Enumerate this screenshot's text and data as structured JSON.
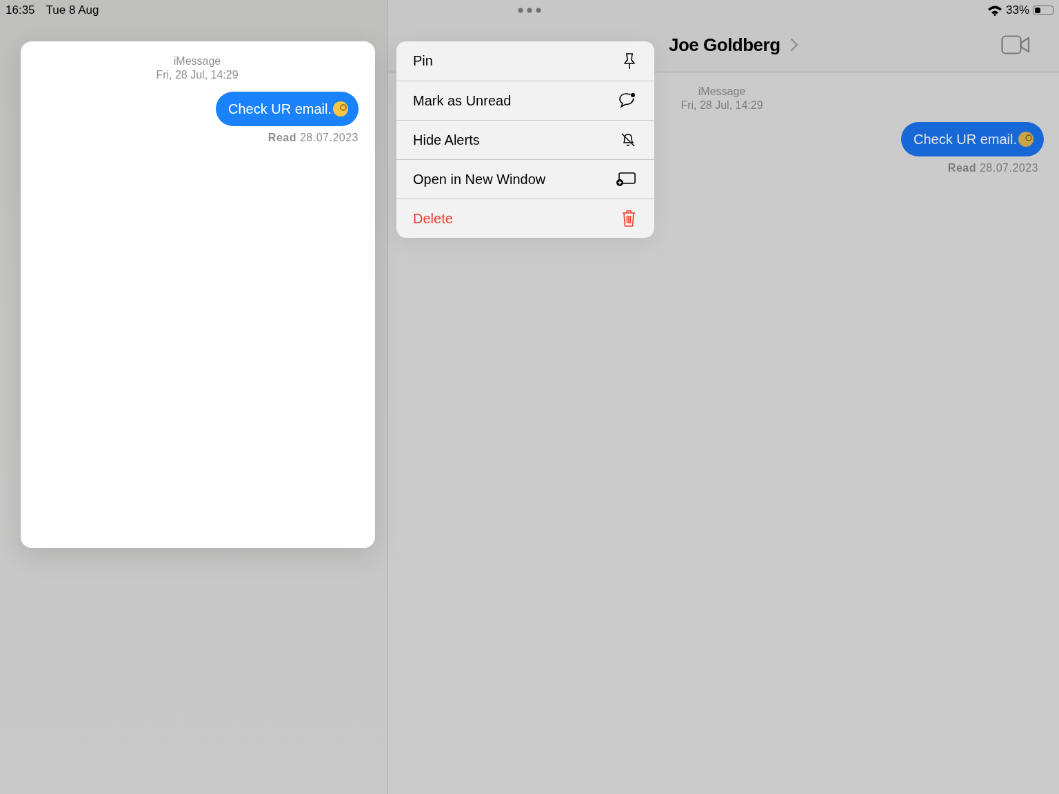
{
  "status_bar": {
    "time": "16:35",
    "date": "Tue 8 Aug",
    "battery": "33%"
  },
  "preview": {
    "service": "iMessage",
    "timestamp": "Fri, 28 Jul, 14:29",
    "message": "Check UR email.",
    "receipt_label": "Read",
    "receipt_date": "28.07.2023"
  },
  "context_menu": [
    {
      "label": "Pin",
      "kind": "normal"
    },
    {
      "label": "Mark as Unread",
      "kind": "normal"
    },
    {
      "label": "Hide Alerts",
      "kind": "normal"
    },
    {
      "label": "Open in New Window",
      "kind": "normal"
    },
    {
      "label": "Delete",
      "kind": "destructive"
    }
  ],
  "conversation": {
    "title": "Joe Goldberg",
    "service": "iMessage",
    "timestamp": "Fri, 28 Jul, 14:29",
    "message": "Check UR email.",
    "receipt_label": "Read",
    "receipt_date": "28.07.2023"
  }
}
